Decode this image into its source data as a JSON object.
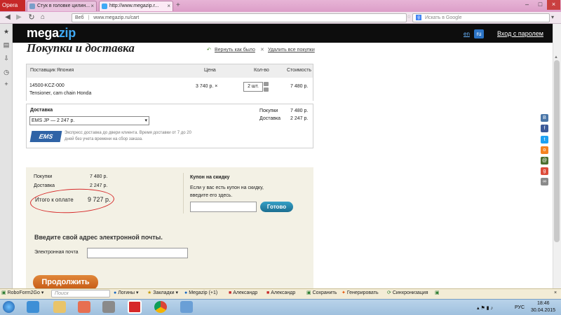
{
  "browser": {
    "menu_label": "Opera",
    "tabs": [
      {
        "label": "Стук в головке цилин..."
      },
      {
        "label": "http://www.megazip.r..."
      }
    ],
    "new_tab": "+",
    "address_prefix": "Веб",
    "address_url": "www.megazip.ru/cart",
    "search_placeholder": "Искать в Google"
  },
  "site": {
    "logo_part1": "mega",
    "logo_part2": "zip",
    "lang_en": "en",
    "lang_ru": "ru",
    "login": "Вход с паролем"
  },
  "cart": {
    "title": "Покупки и доставка",
    "return_link": "Вернуть как было",
    "delete_link": "Удалить все покупки",
    "headers": {
      "supplier": "Поставщик Япония",
      "price": "Цена",
      "qty": "Кол-во",
      "cost": "Стоимость"
    },
    "item": {
      "part_no": "14500-KCZ-000",
      "name": "Tensioner, cam chain Honda",
      "price": "3 740 р. ×",
      "qty": "2 шт.",
      "total": "7 480 р."
    },
    "delivery": {
      "label": "Доставка",
      "option": "EMS JP — 2 247 р.",
      "ems_logo": "EMS",
      "description": "Экспресс доставка до двери клиента. Время доставки от 7 до 20 дней без учета времени на сбор заказа.",
      "purchases_label": "Покупки",
      "purchases_value": "7 480 р.",
      "shipping_label": "Доставка",
      "shipping_value": "2 247 р."
    }
  },
  "summary": {
    "purchases_label": "Покупки",
    "purchases_value": "7 480 р.",
    "shipping_label": "Доставка",
    "shipping_value": "2 247 р.",
    "total_label": "Итого к оплате",
    "total_value": "9 727 р."
  },
  "coupon": {
    "title": "Купон на скидку",
    "text": "Если у вас есть купон на скидку, введите его здесь.",
    "button": "Готово"
  },
  "email": {
    "heading": "Введите свой адрес электронной почты.",
    "label": "Электронная почта",
    "continue": "Продолжить"
  },
  "bookmarks": {
    "roboform": "RoboForm2Go",
    "search_placeholder": "Поиск",
    "logins": "Логины",
    "bookmarks": "Закладки",
    "megazip": "Megazip (+1)",
    "alex1": "Александр",
    "alex2": "Александр",
    "save": "Сохранить",
    "generate": "Генерировать",
    "sync": "Синхронизация"
  },
  "taskbar": {
    "lang": "РУС",
    "time": "18:46",
    "date": "30.04.2015"
  },
  "colors": {
    "accent_blue": "#3fa9f5",
    "continue_orange": "#d4701f",
    "annotation_red": "#d62828"
  }
}
